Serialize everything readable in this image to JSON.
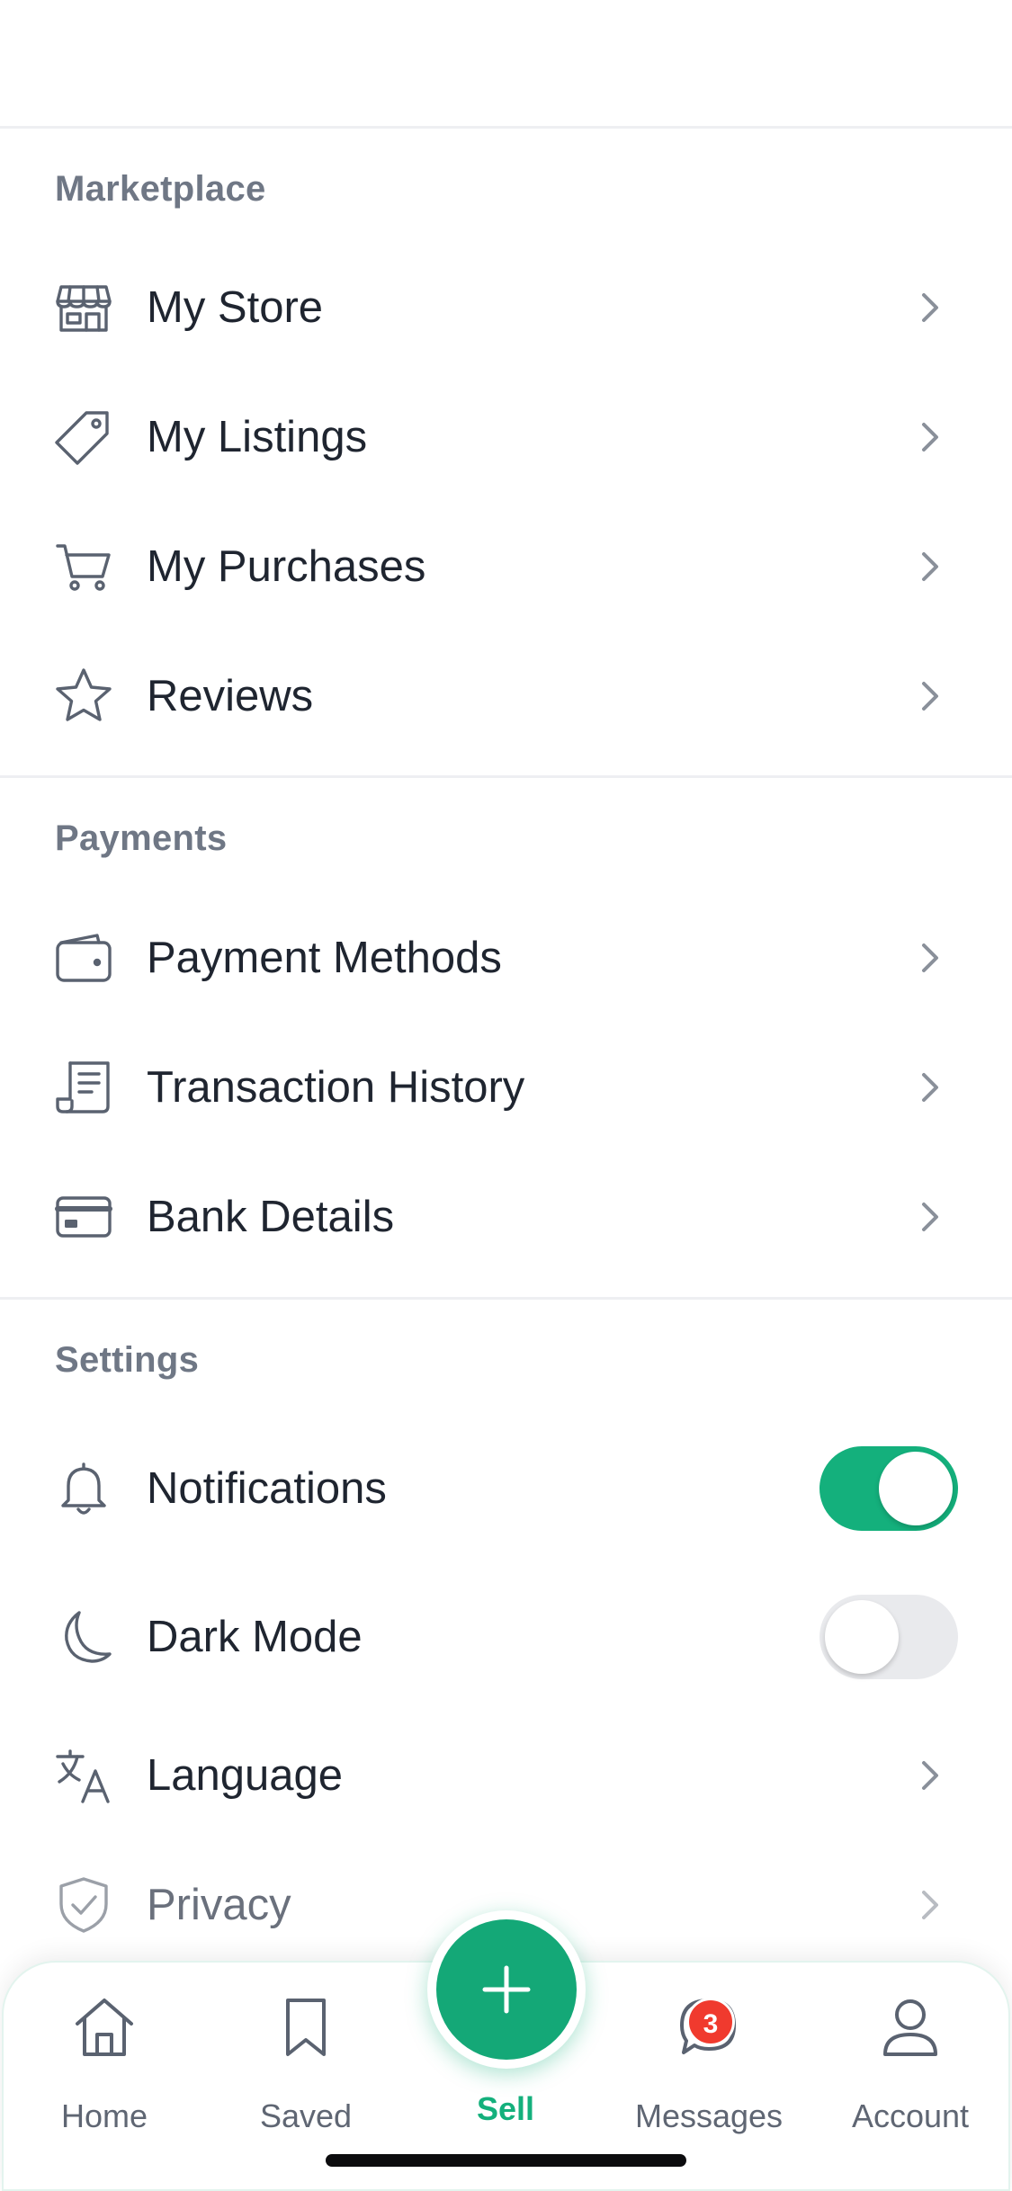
{
  "sections": {
    "marketplace": {
      "title": "Marketplace"
    },
    "payments": {
      "title": "Payments"
    },
    "settings": {
      "title": "Settings"
    }
  },
  "rows": {
    "my_store": {
      "label": "My Store",
      "icon": "store-icon"
    },
    "my_listings": {
      "label": "My Listings",
      "icon": "tag-icon"
    },
    "my_purchases": {
      "label": "My Purchases",
      "icon": "cart-icon"
    },
    "reviews": {
      "label": "Reviews",
      "icon": "star-icon"
    },
    "payment_methods": {
      "label": "Payment Methods",
      "icon": "wallet-icon"
    },
    "transaction_history": {
      "label": "Transaction History",
      "icon": "receipt-icon"
    },
    "bank_details": {
      "label": "Bank Details",
      "icon": "card-icon"
    },
    "notifications": {
      "label": "Notifications",
      "icon": "bell-icon",
      "enabled": true
    },
    "dark_mode": {
      "label": "Dark Mode",
      "icon": "moon-icon",
      "enabled": false
    },
    "language": {
      "label": "Language",
      "icon": "translate-icon"
    },
    "privacy": {
      "label": "Privacy",
      "icon": "shield-check-icon"
    }
  },
  "tabbar": {
    "home": {
      "label": "Home",
      "icon": "home-icon"
    },
    "saved": {
      "label": "Saved",
      "icon": "bookmark-icon"
    },
    "sell": {
      "label": "Sell",
      "icon": "plus-icon"
    },
    "messages": {
      "label": "Messages",
      "icon": "chat-bubble-icon",
      "badge": "3"
    },
    "account": {
      "label": "Account",
      "icon": "user-icon"
    }
  },
  "colors": {
    "accent": "#14b07c",
    "badge": "#f03a2e",
    "section_header": "#6f7785",
    "text": "#1f2530"
  }
}
